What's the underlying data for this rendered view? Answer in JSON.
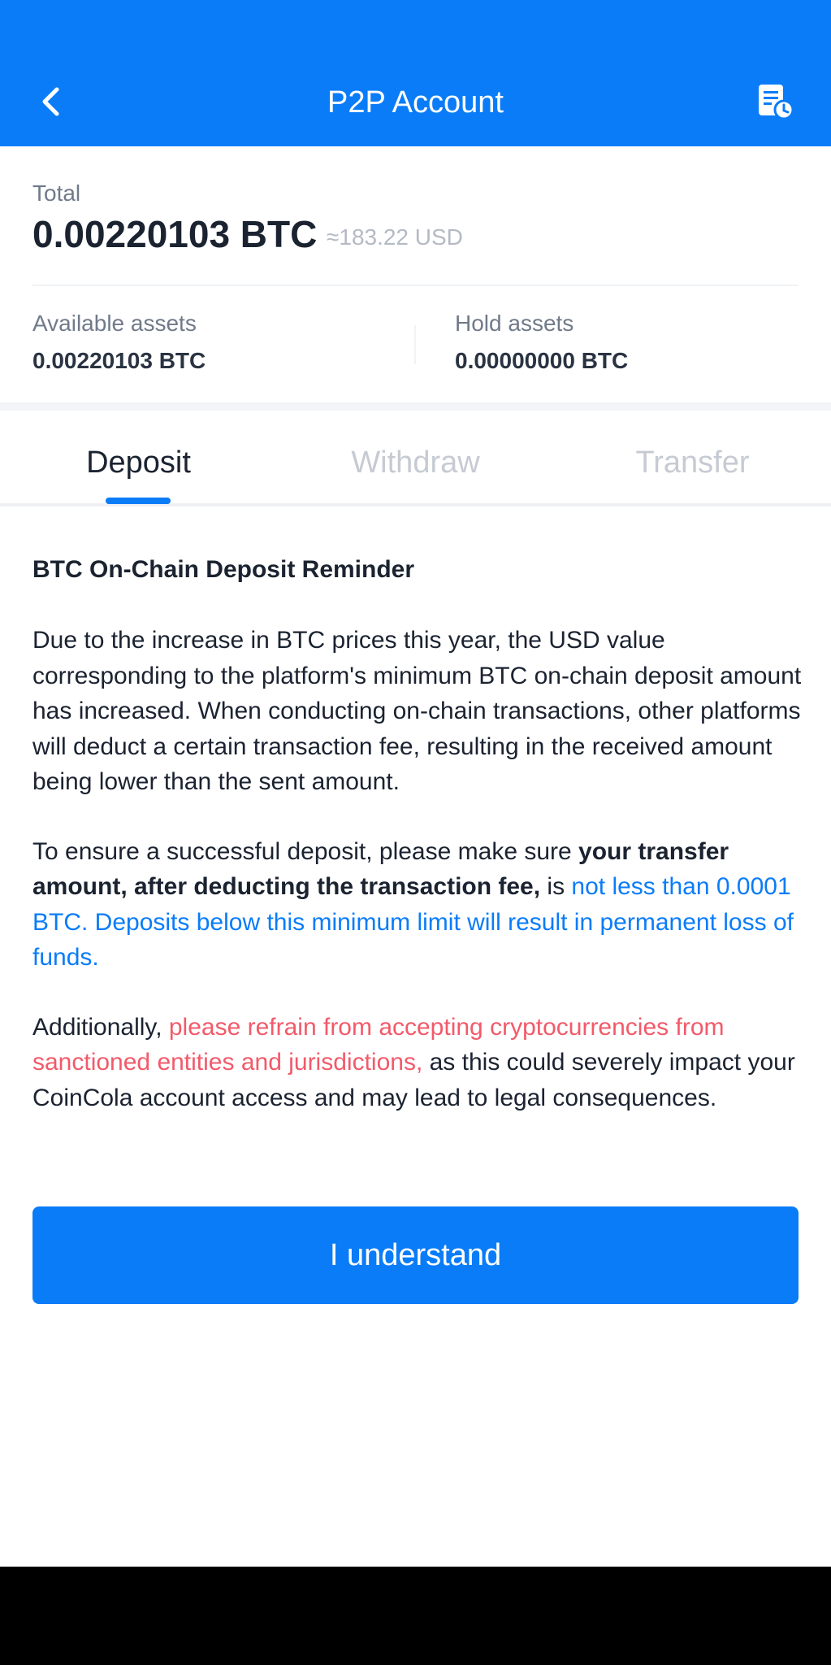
{
  "header": {
    "title": "P2P Account",
    "bg_color": "#0a7cf8",
    "back_icon": "chevron-left-icon",
    "history_icon": "document-clock-icon"
  },
  "summary": {
    "total_label": "Total",
    "total_amount": "0.00220103 BTC",
    "total_usd": "≈183.22 USD",
    "available_label": "Available assets",
    "available_value": "0.00220103 BTC",
    "hold_label": "Hold assets",
    "hold_value": "0.00000000 BTC"
  },
  "tabs": [
    {
      "label": "Deposit",
      "active": true
    },
    {
      "label": "Withdraw",
      "active": false
    },
    {
      "label": "Transfer",
      "active": false
    }
  ],
  "notice": {
    "title": "BTC On-Chain Deposit Reminder",
    "p1": "Due to the increase in BTC prices this year, the USD value corresponding to the platform's minimum BTC on-chain deposit amount has increased. When conducting on-chain transactions, other platforms will deduct a certain transaction fee, resulting in the received amount being lower than the sent amount.",
    "p2_a": "To ensure a successful deposit, please make sure ",
    "p2_bold": "your transfer amount, after deducting the transaction fee,",
    "p2_b": " is ",
    "p2_blue": "not less than 0.0001 BTC. Deposits below this minimum limit will result in permanent loss of funds.",
    "p3_a": "Additionally, ",
    "p3_red": "please refrain from accepting cryptocurrencies from sanctioned entities and jurisdictions,",
    "p3_b": " as this could severely impact your CoinCola account access and may lead to legal consequences."
  },
  "actions": {
    "understand_label": "I understand"
  },
  "colors": {
    "accent": "#0a7cf8",
    "warning": "#f25a6a"
  }
}
